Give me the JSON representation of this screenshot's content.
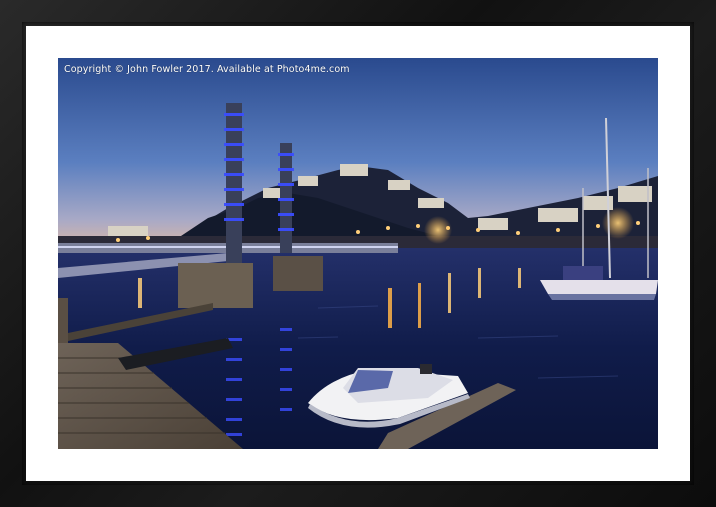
{
  "watermark": {
    "text": "Copyright  © John Fowler  2017. Available at Photo4me.com"
  },
  "colors": {
    "frame": "#141414",
    "mount": "#ffffff",
    "sky_top": "#2a4a8e",
    "sky_bottom": "#d9b7a8",
    "water": "#101c4a",
    "blue_lights": "#3b4dff",
    "warm_lights": "#ffb347"
  },
  "scene": {
    "subject": "harbour-at-dusk",
    "elements": [
      "hillside-town",
      "footbridge-with-blue-lit-towers",
      "pontoon-jetty",
      "moored-motorboat",
      "sailing-yachts",
      "reflections"
    ]
  }
}
